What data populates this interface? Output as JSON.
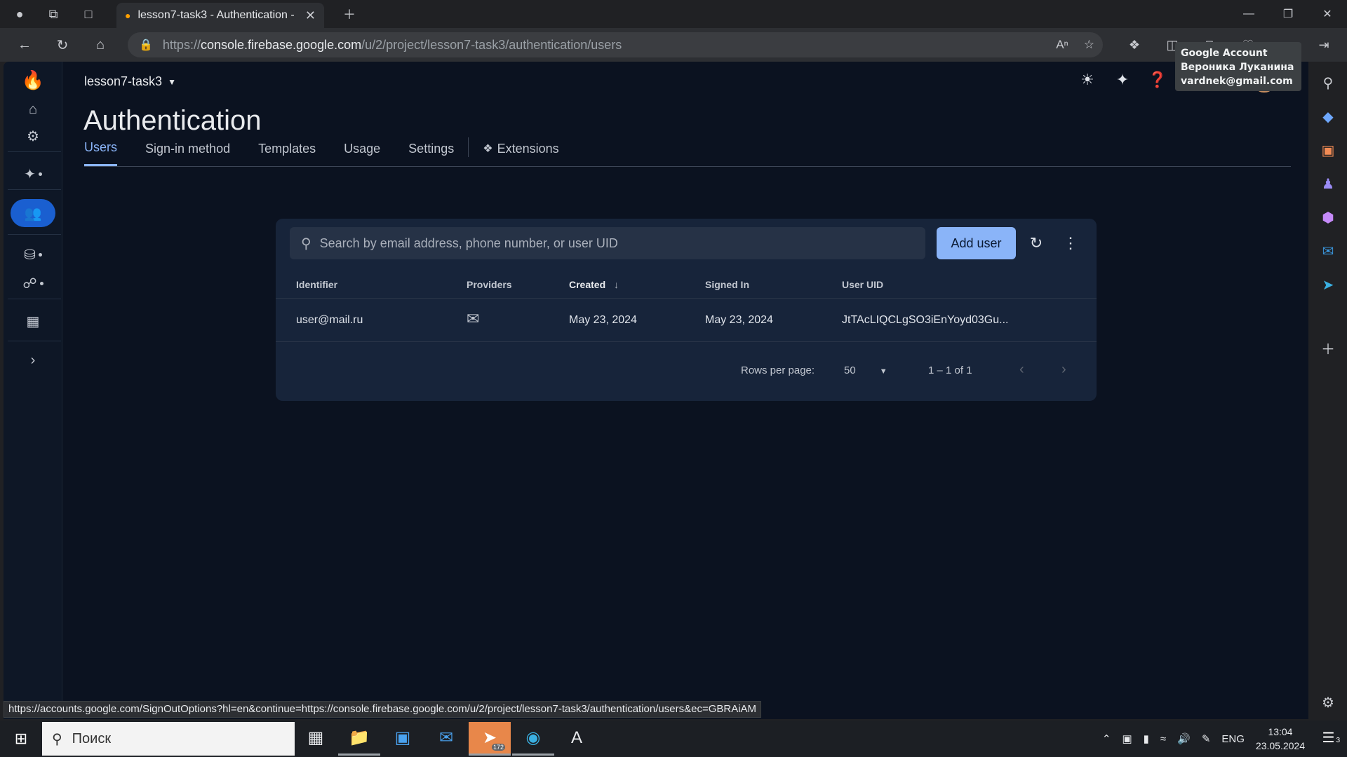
{
  "browser": {
    "tab_title": "lesson7-task3 - Authentication - ",
    "url_prefix": "https://",
    "url_host": "console.firebase.google.com",
    "url_path": "/u/2/project/lesson7-task3/authentication/users"
  },
  "header": {
    "project": "lesson7-task3",
    "title": "Authentication"
  },
  "tabs": [
    "Users",
    "Sign-in method",
    "Templates",
    "Usage",
    "Settings",
    "Extensions"
  ],
  "tooltip": {
    "line1": "Google Account",
    "line2": "Вероника Луканина",
    "line3": "vardnek@gmail.com"
  },
  "users": {
    "search_placeholder": "Search by email address, phone number, or user UID",
    "add_user": "Add user",
    "columns": [
      "Identifier",
      "Providers",
      "Created",
      "Signed In",
      "User UID"
    ],
    "rows": [
      {
        "identifier": "user@mail.ru",
        "created": "May 23, 2024",
        "signed_in": "May 23, 2024",
        "uid": "JtTAcLIQCLgSO3iEnYoyd03Gu..."
      }
    ],
    "rows_per_page_label": "Rows per page:",
    "rows_per_page": "50",
    "range": "1 – 1 of 1"
  },
  "status_url": "https://accounts.google.com/SignOutOptions?hl=en&continue=https://console.firebase.google.com/u/2/project/lesson7-task3/authentication/users&ec=GBRAiAM",
  "taskbar": {
    "search": "Поиск",
    "telegram_badge": "172",
    "lang": "ENG",
    "time": "13:04",
    "date": "23.05.2024",
    "notifications": "3"
  },
  "colors": {
    "accent": "#8ab4f8",
    "active_rail": "#1a5fd0",
    "page_bg": "#0b1220",
    "card_bg": "#17243a"
  }
}
